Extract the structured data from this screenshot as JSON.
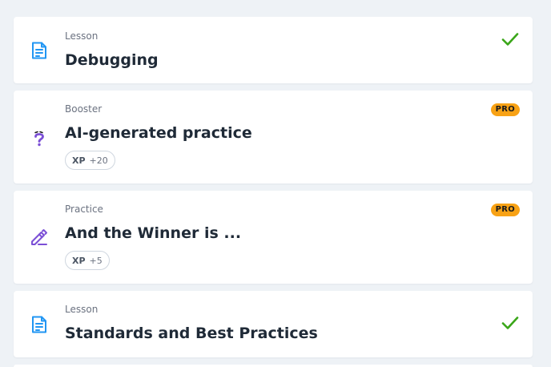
{
  "items": [
    {
      "type": "Lesson",
      "title": "Debugging",
      "icon": "lesson-document-icon",
      "completed": true
    },
    {
      "type": "Booster",
      "title": "AI-generated practice",
      "icon": "question-mark-icon",
      "pro_badge": "PRO",
      "xp_label": "XP",
      "xp_value": "+20"
    },
    {
      "type": "Practice",
      "title": "And the Winner is ...",
      "icon": "pencil-icon",
      "pro_badge": "PRO",
      "xp_label": "XP",
      "xp_value": "+5"
    },
    {
      "type": "Lesson",
      "title": "Standards and Best Practices",
      "icon": "lesson-document-icon",
      "completed": true
    }
  ],
  "colors": {
    "background": "#eef2f6",
    "card": "#ffffff",
    "lesson_icon": "#2196f3",
    "booster_icon": "#7b4fd6",
    "practice_icon": "#7b4fd6",
    "check": "#3aa619",
    "pro_badge": "#f8a215",
    "title_text": "#1f2a37",
    "muted_text": "#6b7280"
  }
}
